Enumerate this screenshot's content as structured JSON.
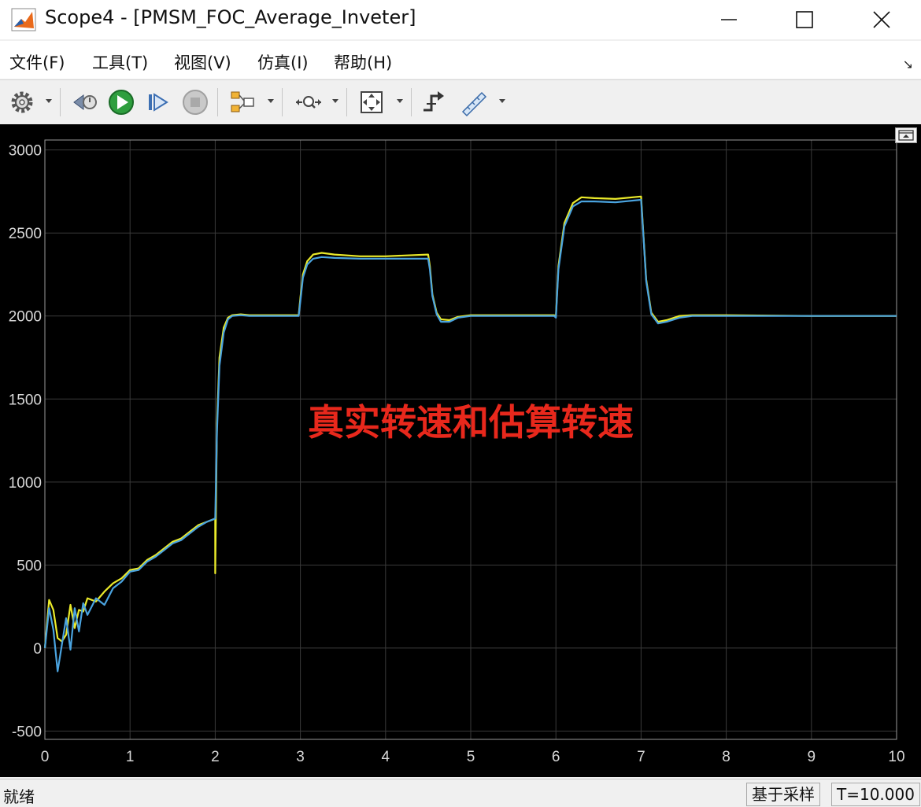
{
  "window": {
    "title": "Scope4 - [PMSM_FOC_Average_Inveter]",
    "minimize_label": "",
    "maximize_label": "",
    "close_label": ""
  },
  "menu": [
    {
      "label": "文件(F)"
    },
    {
      "label": "工具(T)"
    },
    {
      "label": "视图(V)"
    },
    {
      "label": "仿真(I)"
    },
    {
      "label": "帮助(H)"
    }
  ],
  "toolbar": {
    "icons": [
      "settings-icon",
      "step-back-icon",
      "run-icon",
      "step-forward-icon",
      "stop-icon",
      "signal-routing-icon",
      "zoom-time-icon",
      "fit-to-view-icon",
      "triggers-icon",
      "measurements-icon"
    ]
  },
  "plot": {
    "annotation": "真实转速和估算转速",
    "annotation_color": "#e8281c",
    "background": "#000000",
    "grid_color": "#3a3a3a"
  },
  "chart_data": {
    "type": "line",
    "title": "",
    "xlabel": "",
    "ylabel": "",
    "xlim": [
      0,
      10
    ],
    "ylim": [
      -500,
      3100
    ],
    "xticks": [
      0,
      1,
      2,
      3,
      4,
      5,
      6,
      7,
      8,
      9,
      10
    ],
    "yticks": [
      -500,
      0,
      500,
      1000,
      1500,
      2000,
      2500,
      3000
    ],
    "grid": true,
    "series": [
      {
        "color": "#eaea2a",
        "x": [
          0,
          0.05,
          0.1,
          0.15,
          0.2,
          0.25,
          0.3,
          0.35,
          0.4,
          0.45,
          0.5,
          0.6,
          0.7,
          0.8,
          0.9,
          1.0,
          1.1,
          1.2,
          1.3,
          1.4,
          1.5,
          1.6,
          1.7,
          1.8,
          1.9,
          2.0,
          2.0,
          2.02,
          2.05,
          2.1,
          2.15,
          2.2,
          2.3,
          2.4,
          2.5,
          2.7,
          2.98,
          3.0,
          3.03,
          3.08,
          3.15,
          3.25,
          3.4,
          3.7,
          4.0,
          4.5,
          4.52,
          4.55,
          4.6,
          4.65,
          4.75,
          4.85,
          5.0,
          5.5,
          5.98,
          6.0,
          6.03,
          6.1,
          6.2,
          6.3,
          6.45,
          6.7,
          7.0,
          7.02,
          7.06,
          7.12,
          7.2,
          7.3,
          7.45,
          7.6,
          8.0,
          9.0,
          10.0
        ],
        "y": [
          0,
          290,
          230,
          60,
          40,
          80,
          260,
          120,
          230,
          220,
          300,
          280,
          340,
          390,
          420,
          470,
          480,
          530,
          560,
          600,
          640,
          660,
          700,
          740,
          760,
          780,
          450,
          1350,
          1750,
          1930,
          1990,
          2005,
          2010,
          2005,
          2005,
          2005,
          2005,
          2110,
          2250,
          2330,
          2370,
          2380,
          2370,
          2360,
          2360,
          2370,
          2300,
          2130,
          2020,
          1980,
          1975,
          1995,
          2005,
          2005,
          2005,
          2000,
          2300,
          2560,
          2680,
          2715,
          2710,
          2705,
          2720,
          2550,
          2220,
          2020,
          1965,
          1975,
          2000,
          2005,
          2005,
          2000,
          2000
        ]
      },
      {
        "color": "#4aa3df",
        "x": [
          0,
          0.05,
          0.1,
          0.15,
          0.2,
          0.25,
          0.3,
          0.35,
          0.4,
          0.45,
          0.5,
          0.6,
          0.7,
          0.8,
          0.9,
          1.0,
          1.1,
          1.2,
          1.3,
          1.4,
          1.5,
          1.6,
          1.7,
          1.8,
          1.9,
          2.0,
          2.02,
          2.05,
          2.1,
          2.15,
          2.2,
          2.3,
          2.4,
          2.5,
          2.7,
          2.98,
          3.0,
          3.03,
          3.08,
          3.15,
          3.25,
          3.4,
          3.7,
          4.0,
          4.5,
          4.52,
          4.55,
          4.6,
          4.65,
          4.75,
          4.85,
          5.0,
          5.5,
          5.98,
          6.0,
          6.03,
          6.1,
          6.2,
          6.3,
          6.45,
          6.7,
          7.0,
          7.02,
          7.06,
          7.12,
          7.2,
          7.3,
          7.45,
          7.6,
          8.0,
          9.0,
          10.0
        ],
        "y": [
          0,
          240,
          110,
          -140,
          20,
          180,
          -10,
          240,
          100,
          270,
          200,
          300,
          260,
          360,
          400,
          460,
          470,
          520,
          550,
          590,
          630,
          650,
          690,
          730,
          760,
          780,
          1300,
          1700,
          1900,
          1980,
          2000,
          2005,
          2000,
          2000,
          2000,
          2000,
          2090,
          2230,
          2310,
          2345,
          2355,
          2350,
          2345,
          2345,
          2345,
          2280,
          2120,
          2010,
          1965,
          1965,
          1990,
          2000,
          2000,
          2000,
          1990,
          2280,
          2540,
          2660,
          2690,
          2690,
          2685,
          2700,
          2540,
          2210,
          2010,
          1955,
          1965,
          1990,
          2000,
          2000,
          2000,
          2000
        ]
      }
    ]
  },
  "status": {
    "ready": "就绪",
    "sample_mode": "基于采样",
    "time": "T=10.000"
  }
}
